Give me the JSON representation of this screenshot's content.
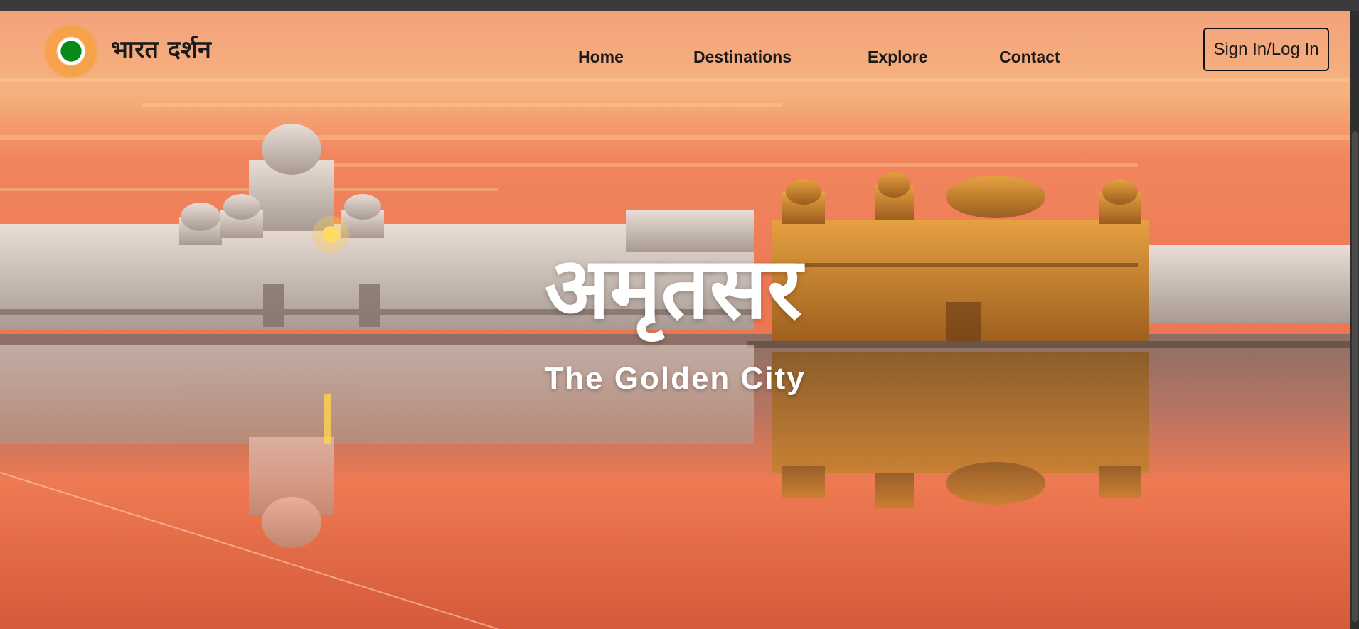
{
  "nav": {
    "brand": "भारत दर्शन",
    "logo_icon": "tricolor-chakra-logo",
    "links": [
      {
        "label": "Home"
      },
      {
        "label": "Destinations"
      },
      {
        "label": "Explore"
      },
      {
        "label": "Contact"
      }
    ],
    "signin_label": "Sign In/Log In"
  },
  "hero": {
    "title": "अमृतसर",
    "subtitle": "The Golden City",
    "background": "golden-temple-sunset-photo"
  },
  "colors": {
    "sky_top": "#f5a878",
    "sky_mid": "#f07a4c",
    "water": "#ee7a52",
    "temple_gold": "#d08a2c",
    "text_dark": "#1a1a1a",
    "text_light": "#ffffff"
  }
}
